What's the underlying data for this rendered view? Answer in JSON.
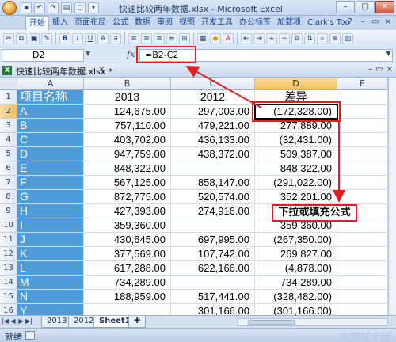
{
  "window": {
    "title": "快速比较两年数据.xlsx - Microsoft Excel",
    "minimize": "–",
    "maximize": "□",
    "close": "✕"
  },
  "ribbon_tabs": [
    "开始",
    "插入",
    "页面布局",
    "公式",
    "数据",
    "审阅",
    "视图",
    "开发工具",
    "办公标签",
    "加载项",
    "Clark's Too"
  ],
  "formula_bar": {
    "name_box": "D2",
    "fx": "fx",
    "formula": "=B2-C2"
  },
  "document": {
    "tab_title": "快速比较两年数据.xlsx *",
    "close_label": "×"
  },
  "columns": [
    "A",
    "B",
    "C",
    "D",
    "E"
  ],
  "header_row": {
    "row": "1",
    "name": "项目名称",
    "y2013": "2013",
    "y2012": "2012",
    "diff": "差异"
  },
  "rows": [
    {
      "row": "2",
      "name": "A",
      "b": "124,675.00",
      "c": "297,003.00",
      "d": "(172,328.00)"
    },
    {
      "row": "3",
      "name": "B",
      "b": "757,110.00",
      "c": "479,221.00",
      "d": "277,889.00"
    },
    {
      "row": "4",
      "name": "C",
      "b": "403,702.00",
      "c": "436,133.00",
      "d": "(32,431.00)"
    },
    {
      "row": "5",
      "name": "D",
      "b": "947,759.00",
      "c": "438,372.00",
      "d": "509,387.00"
    },
    {
      "row": "6",
      "name": "E",
      "b": "848,322.00",
      "c": "",
      "d": "848,322.00"
    },
    {
      "row": "7",
      "name": "F",
      "b": "567,125.00",
      "c": "858,147.00",
      "d": "(291,022.00)"
    },
    {
      "row": "8",
      "name": "G",
      "b": "872,775.00",
      "c": "520,574.00",
      "d": "352,201.00"
    },
    {
      "row": "9",
      "name": "H",
      "b": "427,393.00",
      "c": "274,916.00",
      "d": ""
    },
    {
      "row": "10",
      "name": "I",
      "b": "359,360.00",
      "c": "",
      "d": "359,360.00"
    },
    {
      "row": "11",
      "name": "J",
      "b": "430,645.00",
      "c": "697,995.00",
      "d": "(267,350.00)"
    },
    {
      "row": "12",
      "name": "K",
      "b": "377,569.00",
      "c": "107,742.00",
      "d": "269,827.00"
    },
    {
      "row": "13",
      "name": "L",
      "b": "617,288.00",
      "c": "622,166.00",
      "d": "(4,878.00)"
    },
    {
      "row": "14",
      "name": "M",
      "b": "734,289.00",
      "c": "",
      "d": "734,289.00"
    },
    {
      "row": "15",
      "name": "N",
      "b": "188,959.00",
      "c": "517,441.00",
      "d": "(328,482.00)"
    },
    {
      "row": "16",
      "name": "Y",
      "b": "",
      "c": "301,166.00",
      "d": "(301,166.00)"
    }
  ],
  "callout": "下拉或填充公式",
  "sheet_tabs": [
    "2013",
    "2012",
    "Sheet1"
  ],
  "status": {
    "text": "就绪",
    "watermark": "电脑技术网"
  },
  "colors": {
    "name_column_bg": "#4f9cd8",
    "annotation_red": "#e02020",
    "selected_header": "#f0bf5e"
  }
}
